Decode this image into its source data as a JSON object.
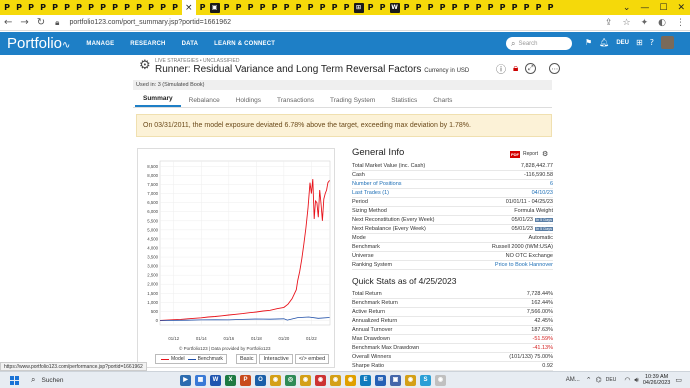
{
  "browser": {
    "tab_glyphs": [
      "P",
      "P",
      "P",
      "P",
      "P",
      "P",
      "P",
      "P",
      "P",
      "P",
      "P",
      "P",
      "P",
      "P",
      "P"
    ],
    "tab_glyphs_after": [
      "P",
      "▣",
      "P",
      "P",
      "P",
      "P",
      "P",
      "P",
      "P",
      "P",
      "P",
      "P",
      "P",
      "⊞",
      "P",
      "P",
      "W",
      "P",
      "P",
      "P",
      "P",
      "P",
      "P",
      "P",
      "P",
      "P",
      "P",
      "P",
      "P",
      "P"
    ],
    "close_glyph": "×",
    "new_tab": "+",
    "url": "portfolio123.com/port_summary.jsp?portid=1661962",
    "status_url": "https://www.portfolio123.com/performance.jsp?portid=1661962"
  },
  "sitenav": {
    "logo": "Portfolio",
    "menu": [
      "MANAGE",
      "RESEARCH",
      "DATA",
      "LEARN & CONNECT"
    ],
    "search_placeholder": "Search",
    "lang": "DEU"
  },
  "header": {
    "breadcrumb": "LIVE STRATEGIES • UNCLASSIFIED",
    "title": "Runner: Residual Variance and Long Term Reversal Factors",
    "currency": "Currency in USD",
    "used_in": "Used in: 3 (Simulated Book)"
  },
  "tabs": [
    "Summary",
    "Rebalance",
    "Holdings",
    "Transactions",
    "Trading System",
    "Statistics",
    "Charts"
  ],
  "alert": "On 03/31/2011, the model exposure deviated 6.78% above the target, exceeding max deviation by 1.78%.",
  "general_info": {
    "title": "General Info",
    "pdf_tag": "PDF",
    "report_label": "Report",
    "rows": [
      {
        "k": "Total Market Value (inc. Cash)",
        "v": "7,828,442.77"
      },
      {
        "k": "Cash",
        "v": "-116,590.58"
      },
      {
        "k": "Number of Positions",
        "v": "6",
        "link": true
      },
      {
        "k": "Last Trades (1)",
        "v": "04/10/23",
        "link": true
      },
      {
        "k": "Period",
        "v": "01/01/11 - 04/25/23"
      },
      {
        "k": "Sizing Method",
        "v": "Formula Weight"
      },
      {
        "k": "Next Reconstitution (Every Week)",
        "v": "05/01/23",
        "badge": "In 5 Days"
      },
      {
        "k": "Next Rebalance (Every Week)",
        "v": "05/01/23",
        "badge": "In 5 Days"
      },
      {
        "k": "Mode",
        "v": "Automatic"
      },
      {
        "k": "Benchmark",
        "v": "Russell 2000 (IWM:USA)"
      },
      {
        "k": "Universe",
        "v": "NO OTC Exchange"
      },
      {
        "k": "Ranking System",
        "v": "Price to Book Hannover",
        "link": true
      }
    ]
  },
  "quick_stats": {
    "title": "Quick Stats as of 4/25/2023",
    "rows": [
      {
        "k": "Total Return",
        "v": "7,728.44%"
      },
      {
        "k": "Benchmark Return",
        "v": "162.44%"
      },
      {
        "k": "Active Return",
        "v": "7,566.00%"
      },
      {
        "k": "Annualized Return",
        "v": "42.45%"
      },
      {
        "k": "Annual Turnover",
        "v": "187.63%"
      },
      {
        "k": "Max Drawdown",
        "v": "-51.59%",
        "red": true
      },
      {
        "k": "Benchmark Max Drawdown",
        "v": "-41.13%",
        "red": true
      },
      {
        "k": "Overall Winners",
        "v": "(101/133) 75.00%"
      },
      {
        "k": "Sharpe Ratio",
        "v": "0.92"
      }
    ]
  },
  "chart_data": {
    "type": "line",
    "xlabel": "",
    "ylabel": "",
    "x_tick_labels": [
      "01/12",
      "01/14",
      "01/16",
      "01/18",
      "01/20",
      "01/22"
    ],
    "y_ticks": [
      0,
      500,
      1000,
      1500,
      2000,
      2500,
      3000,
      3500,
      4000,
      4500,
      5000,
      5500,
      6000,
      6500,
      7000,
      7500,
      8000,
      8500
    ],
    "y_tick_labels": [
      "0",
      "500",
      "1,000",
      "1,500",
      "2,000",
      "2,500",
      "3,000",
      "3,500",
      "4,000",
      "4,500",
      "5,000",
      "5,500",
      "6,000",
      "6,500",
      "7,000",
      "7,500",
      "8,000",
      "8,500"
    ],
    "ylim": [
      -250,
      8800
    ],
    "xlim": [
      2011.0,
      2023.35
    ],
    "grid": true,
    "series": [
      {
        "name": "Model",
        "color": "#e8141c",
        "x": [
          2011.0,
          2011.5,
          2012.0,
          2012.5,
          2013.0,
          2013.5,
          2014.0,
          2014.5,
          2015.0,
          2015.5,
          2016.0,
          2016.5,
          2017.0,
          2017.5,
          2018.0,
          2018.5,
          2019.0,
          2019.5,
          2020.0,
          2020.3,
          2020.6,
          2020.9,
          2021.0,
          2021.15,
          2021.3,
          2021.45,
          2021.6,
          2021.75,
          2021.9,
          2022.0,
          2022.1,
          2022.2,
          2022.3,
          2022.4,
          2022.5,
          2022.6,
          2022.7,
          2022.8,
          2022.9,
          2023.0,
          2023.1,
          2023.2,
          2023.32
        ],
        "values": [
          0,
          20,
          40,
          60,
          90,
          120,
          150,
          190,
          220,
          260,
          300,
          340,
          380,
          430,
          470,
          520,
          560,
          650,
          720,
          900,
          1200,
          1700,
          2200,
          2700,
          3400,
          4200,
          5100,
          6200,
          7600,
          7000,
          7800,
          5600,
          6600,
          6500,
          5700,
          7200,
          6400,
          5500,
          6700,
          7000,
          7200,
          7600,
          7728
        ]
      },
      {
        "name": "Benchmark",
        "color": "#1f4fa8",
        "x": [
          2011.0,
          2012.0,
          2013.0,
          2014.0,
          2015.0,
          2016.0,
          2017.0,
          2018.0,
          2019.0,
          2020.0,
          2020.25,
          2021.0,
          2021.8,
          2022.5,
          2023.32
        ],
        "values": [
          0,
          5,
          15,
          30,
          35,
          30,
          60,
          80,
          70,
          90,
          20,
          160,
          190,
          120,
          162
        ]
      }
    ],
    "legend": [
      "Model",
      "Benchmark"
    ],
    "footer": "© Portfolio123 | Data provided by Portfolio123",
    "buttons": [
      "Basic",
      "Interactive",
      "</> embed"
    ]
  },
  "taskbar": {
    "search": "Suchen",
    "weather": "AM...",
    "lang": "DEU",
    "time": "10:39 AM",
    "date": "04/26/2023",
    "apps": [
      {
        "label": "▶",
        "color": "#2c6cb0"
      },
      {
        "label": "▦",
        "color": "#3a7ad6"
      },
      {
        "label": "W",
        "color": "#1f55b0"
      },
      {
        "label": "X",
        "color": "#1d7a42"
      },
      {
        "label": "P",
        "color": "#c84a1c"
      },
      {
        "label": "O",
        "color": "#1a5fa8"
      },
      {
        "label": "◉",
        "color": "#d4a017"
      },
      {
        "label": "◎",
        "color": "#2e8b57"
      },
      {
        "label": "◉",
        "color": "#d4a017"
      },
      {
        "label": "◉",
        "color": "#c33"
      },
      {
        "label": "◉",
        "color": "#d4a017"
      },
      {
        "label": "◉",
        "color": "#e0a000"
      },
      {
        "label": "E",
        "color": "#0f7bbd"
      },
      {
        "label": "✉",
        "color": "#2561b5"
      },
      {
        "label": "▣",
        "color": "#4466aa"
      },
      {
        "label": "◉",
        "color": "#d4a017"
      },
      {
        "label": "S",
        "color": "#2a9fd6"
      },
      {
        "label": "◉",
        "color": "#c0c0c0"
      }
    ]
  }
}
